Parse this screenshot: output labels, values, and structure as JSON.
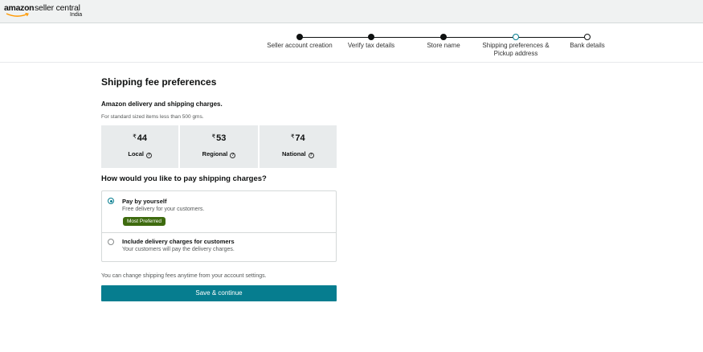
{
  "header": {
    "brand": "amazon",
    "product": "seller central",
    "region": "India"
  },
  "stepper": {
    "steps": [
      {
        "label": "Seller account creation",
        "state": "done"
      },
      {
        "label": "Verify tax details",
        "state": "done"
      },
      {
        "label": "Store name",
        "state": "done"
      },
      {
        "label": "Shipping preferences & Pickup address",
        "state": "current"
      },
      {
        "label": "Bank details",
        "state": "future"
      }
    ]
  },
  "main": {
    "title": "Shipping fee preferences",
    "charges_heading": "Amazon delivery and shipping charges.",
    "charges_note": "For standard sized items less than 500 gms.",
    "currency_symbol": "₹",
    "fees": [
      {
        "amount": "44",
        "label": "Local"
      },
      {
        "amount": "53",
        "label": "Regional"
      },
      {
        "amount": "74",
        "label": "National"
      }
    ],
    "question": "How would you like to pay shipping charges?",
    "options": [
      {
        "title": "Pay by yourself",
        "description": "Free delivery for your customers.",
        "badge": "Most Preferred",
        "selected": true
      },
      {
        "title": "Include delivery charges for customers",
        "description": "Your customers will pay the delivery charges.",
        "selected": false
      }
    ],
    "footer_note": "You can change shipping fees anytime from your account settings.",
    "save_label": "Save & continue"
  },
  "colors": {
    "accent": "#067d8f",
    "badge": "#3e6b0f",
    "fee_card": "#e8ebec"
  }
}
